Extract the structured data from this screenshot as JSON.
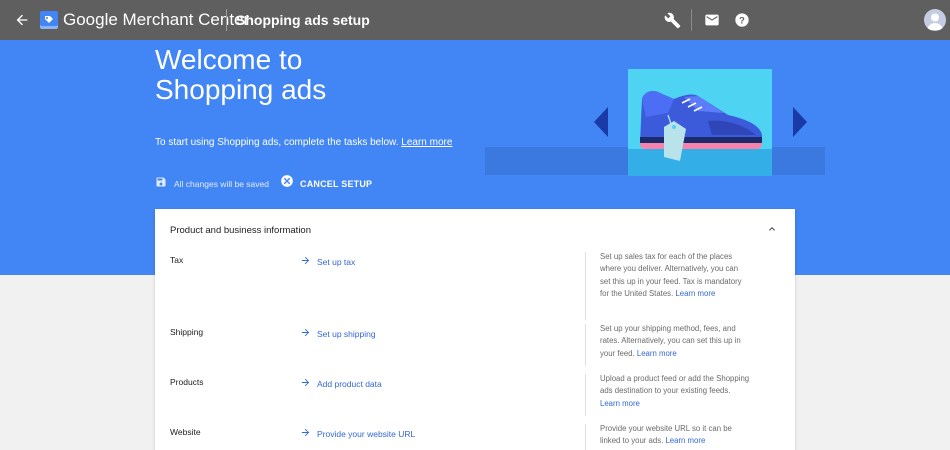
{
  "topbar": {
    "back_icon": "arrow-back-icon",
    "logo_icon": "merchant-center-logo-icon",
    "brand": "Google Merchant Center",
    "page_title": "Shopping ads setup",
    "tools_icon": "wrench-icon",
    "mail_icon": "mail-icon",
    "help_icon": "help-icon",
    "avatar_icon": "account-avatar-icon"
  },
  "hero": {
    "title": "Welcome to\nShopping ads",
    "intro_text": "To start using Shopping ads, complete the tasks below.",
    "learn_more": "Learn more",
    "saved_icon": "save-icon",
    "saved_text": "All changes will be saved",
    "cancel_icon": "cancel-circle-icon",
    "cancel_label": "CANCEL SETUP",
    "illustration": "sneaker-with-price-tag-illustration",
    "prev_icon": "triangle-left-icon",
    "next_icon": "triangle-right-icon"
  },
  "card": {
    "title": "Product and business information",
    "collapse_icon": "chevron-up-icon",
    "tasks": [
      {
        "label": "Tax",
        "link": "Set up tax",
        "description": "Set up sales tax for each of the places where you deliver. Alternatively, you can set this up in your feed. Tax is mandatory for the United States.",
        "learn_more": "Learn more"
      },
      {
        "label": "Shipping",
        "link": "Set up shipping",
        "description": "Set up your shipping method, fees, and rates. Alternatively, you can set this up in your feed.",
        "learn_more": "Learn more"
      },
      {
        "label": "Products",
        "link": "Add product data",
        "description": "Upload a product feed or add the Shopping ads destination to your existing feeds.",
        "learn_more": "Learn more"
      },
      {
        "label": "Website",
        "link": "Provide your website URL",
        "description": "Provide your website URL so it can be linked to your ads.",
        "learn_more": "Learn more"
      }
    ]
  },
  "colors": {
    "topbar": "#5f5f5f",
    "hero": "#4285f4",
    "link": "#3367d6",
    "page_bg": "#f1f1f1"
  }
}
